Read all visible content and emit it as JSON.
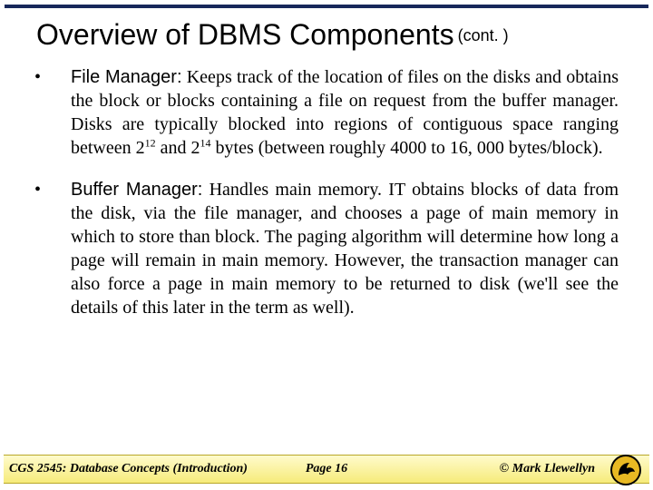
{
  "title": {
    "main": "Overview of DBMS Components",
    "cont": "(cont. )"
  },
  "bullets": [
    {
      "marker": "•",
      "term": "File Manager:",
      "text_before_sup1": "  Keeps track of the location of files on the disks and obtains the block or blocks containing a file on request from the buffer manager.  Disks are typically blocked into regions of contiguous space ranging between 2",
      "sup1": "12",
      "text_mid": " and 2",
      "sup2": "14",
      "text_after": " bytes (between roughly 4000 to 16, 000 bytes/block)."
    },
    {
      "marker": "•",
      "term": "Buffer Manager:",
      "text": "  Handles main memory.  IT obtains blocks of data from the disk, via the file manager, and chooses a page of main memory in which to store than block.  The paging algorithm will determine how long a page will remain in main memory.  However, the transaction manager can also force a page in main memory to be returned to disk (we'll see the details of this later in the term as well)."
    }
  ],
  "footer": {
    "left": "CGS 2545: Database Concepts  (Introduction)",
    "center": "Page 16",
    "right": "© Mark Llewellyn"
  }
}
